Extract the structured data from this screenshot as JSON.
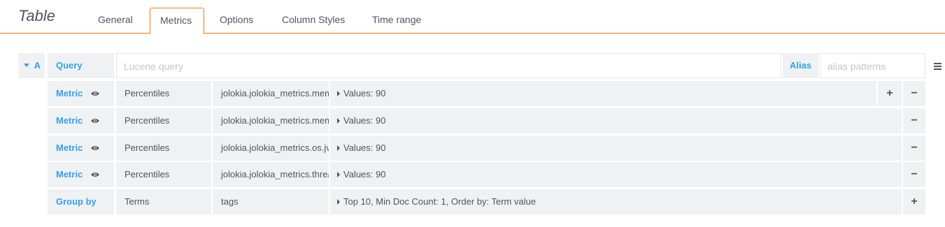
{
  "panel": {
    "title": "Table"
  },
  "tabs": [
    {
      "label": "General"
    },
    {
      "label": "Metrics"
    },
    {
      "label": "Options"
    },
    {
      "label": "Column Styles"
    },
    {
      "label": "Time range"
    }
  ],
  "query_row": {
    "ref_id": "A",
    "query_label": "Query",
    "query_placeholder": "Lucene query",
    "alias_label": "Alias",
    "alias_placeholder": "alias patterns"
  },
  "metrics": [
    {
      "label": "Metric",
      "type": "Percentiles",
      "field": "jolokia.jolokia_metrics.mem",
      "settings": "Values: 90"
    },
    {
      "label": "Metric",
      "type": "Percentiles",
      "field": "jolokia.jolokia_metrics.mem",
      "settings": "Values: 90"
    },
    {
      "label": "Metric",
      "type": "Percentiles",
      "field": "jolokia.jolokia_metrics.os.jv",
      "settings": "Values: 90"
    },
    {
      "label": "Metric",
      "type": "Percentiles",
      "field": "jolokia.jolokia_metrics.threa",
      "settings": "Values: 90"
    }
  ],
  "group_by": {
    "label": "Group by",
    "type": "Terms",
    "field": "tags",
    "settings": "Top 10, Min Doc Count: 1, Order by: Term value"
  },
  "buttons": {
    "add": "+",
    "remove": "−"
  },
  "icons": {
    "eye": "eye-icon",
    "menu": "hamburger-menu-icon",
    "collapse": "caret-down-icon"
  },
  "colors": {
    "accent": "#eb7b18",
    "keyword": "#33a2e5",
    "cell_bg": "#f0f1f3"
  }
}
